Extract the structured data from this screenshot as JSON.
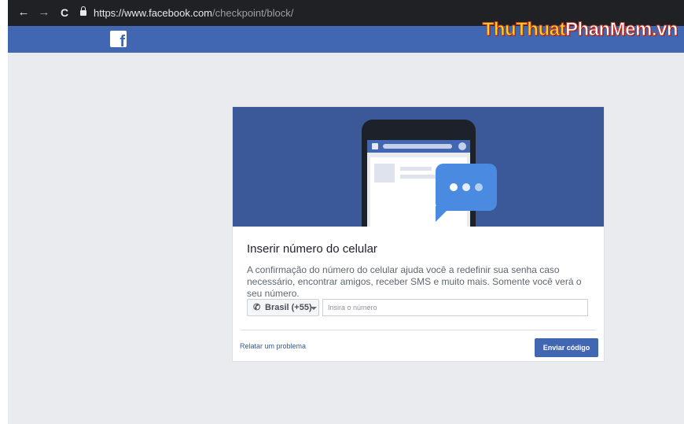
{
  "browser": {
    "url_host": "https://www.facebook.com",
    "url_path": "/checkpoint/block/",
    "back_icon": "←",
    "forward_icon": "→",
    "reload_icon": "C"
  },
  "header": {
    "logo_letter": "f",
    "watermark_part1": "ThuThuat",
    "watermark_part2": "PhanMem.vn"
  },
  "card": {
    "title": "Inserir número do celular",
    "description": "A confirmação do número do celular ajuda você a redefinir sua senha caso necessário, encontrar amigos, receber SMS e muito mais. Somente você verá o seu número.",
    "country_selector": {
      "label": "Brasil (+55)",
      "icon": "phone-icon"
    },
    "phone_input": {
      "value": "",
      "placeholder": "Insira o número"
    },
    "report_link": "Relatar um problema",
    "send_button": "Enviar código"
  },
  "colors": {
    "brand_blue": "#4267b2",
    "hero_blue": "#3b5998",
    "bubble_blue": "#4a8ae0",
    "page_bg": "#e9ebee",
    "browser_bar": "#202124"
  }
}
